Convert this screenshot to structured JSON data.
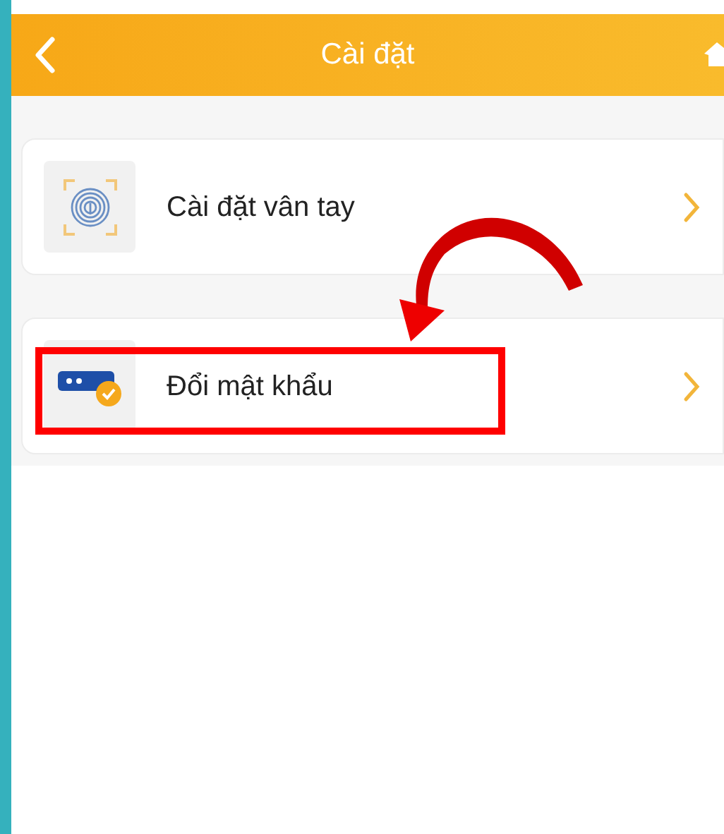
{
  "header": {
    "title": "Cài đặt"
  },
  "items": [
    {
      "kind": "fingerprint",
      "label": "Cài đặt vân tay",
      "highlighted": false
    },
    {
      "kind": "password",
      "label": "Đổi mật khẩu",
      "highlighted": true
    }
  ]
}
